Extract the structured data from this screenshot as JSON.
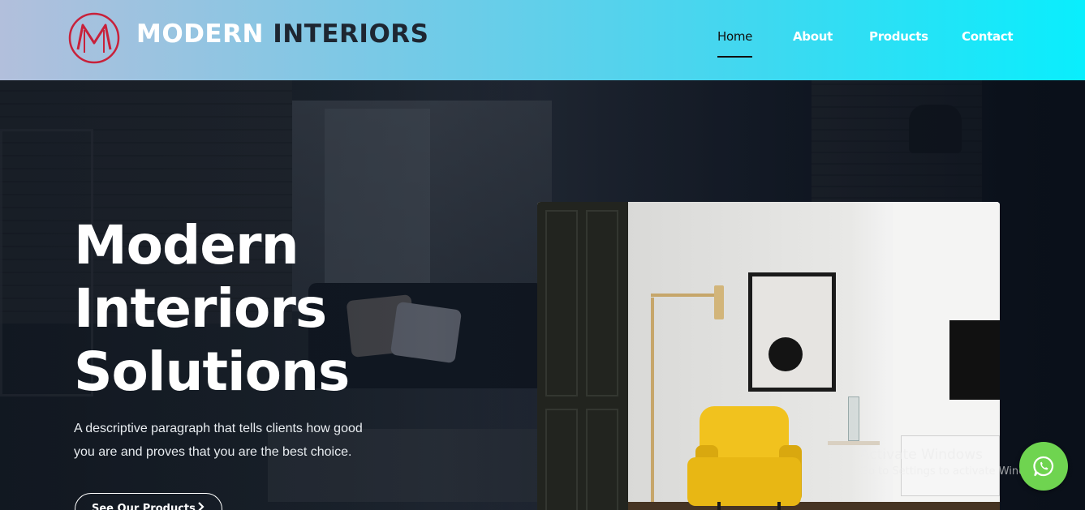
{
  "header": {
    "brand_part1": "MODERN",
    "brand_part2": "INTERIORS",
    "logo_icon": "m-monogram-logo",
    "colors": {
      "gradient_start": "#b2bfdc",
      "gradient_end": "#09eefd",
      "logo_red": "#c8213a"
    }
  },
  "nav": {
    "items": [
      {
        "label": "Home",
        "active": true
      },
      {
        "label": "About",
        "active": false
      },
      {
        "label": "Products",
        "active": false
      },
      {
        "label": "Contact",
        "active": false
      }
    ]
  },
  "hero": {
    "title_line1": "Modern",
    "title_line2": "Interiors",
    "title_line3": "Solutions",
    "description_line1": "A descriptive paragraph that tells clients how good",
    "description_line2": "you are and proves that you are the best choice.",
    "cta_label": "See Our Products",
    "cta_icon": "chevron-right-icon"
  },
  "overlay": {
    "activate_title": "Activate Windows",
    "activate_subtitle": "Go to Settings to activate Windows."
  },
  "whatsapp": {
    "icon": "whatsapp-icon",
    "color": "#6fd450"
  }
}
